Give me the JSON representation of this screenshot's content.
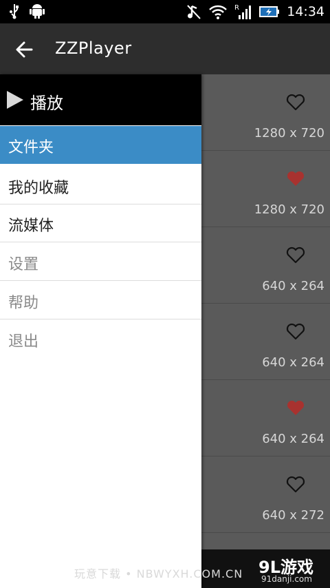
{
  "status_bar": {
    "time": "14:34",
    "left_icons": [
      "usb-icon",
      "android-debug-icon"
    ],
    "right_icons": [
      "mute-icon",
      "wifi-icon",
      "signal-roaming-icon",
      "battery-charging-icon"
    ]
  },
  "action_bar": {
    "back_icon": "arrow-left-icon",
    "title": "ZZPlayer"
  },
  "drawer": {
    "play_label": "播放",
    "items": [
      {
        "label": "文件夹",
        "state": "selected"
      },
      {
        "label": "我的收藏",
        "state": "active"
      },
      {
        "label": "流媒体",
        "state": "active"
      },
      {
        "label": "设置",
        "state": "disabled"
      },
      {
        "label": "帮助",
        "state": "disabled"
      },
      {
        "label": "退出",
        "state": "disabled"
      }
    ]
  },
  "content": {
    "items": [
      {
        "favorite": false,
        "resolution": "1280 x 720"
      },
      {
        "favorite": true,
        "resolution": "1280 x 720"
      },
      {
        "favorite": false,
        "resolution": "640 x 264"
      },
      {
        "favorite": false,
        "resolution": "640 x 264"
      },
      {
        "favorite": true,
        "resolution": "640 x 264"
      },
      {
        "favorite": false,
        "resolution": "640 x 272"
      }
    ]
  },
  "watermark": {
    "text": "玩意下载 • NBWYXH.COM.CN",
    "logo": "9L游戏",
    "logo_sub": "91danji.com"
  },
  "colors": {
    "selected": "#3b8cc6",
    "heart_filled": "#a8322f",
    "actionbar": "#2d2d2d"
  }
}
